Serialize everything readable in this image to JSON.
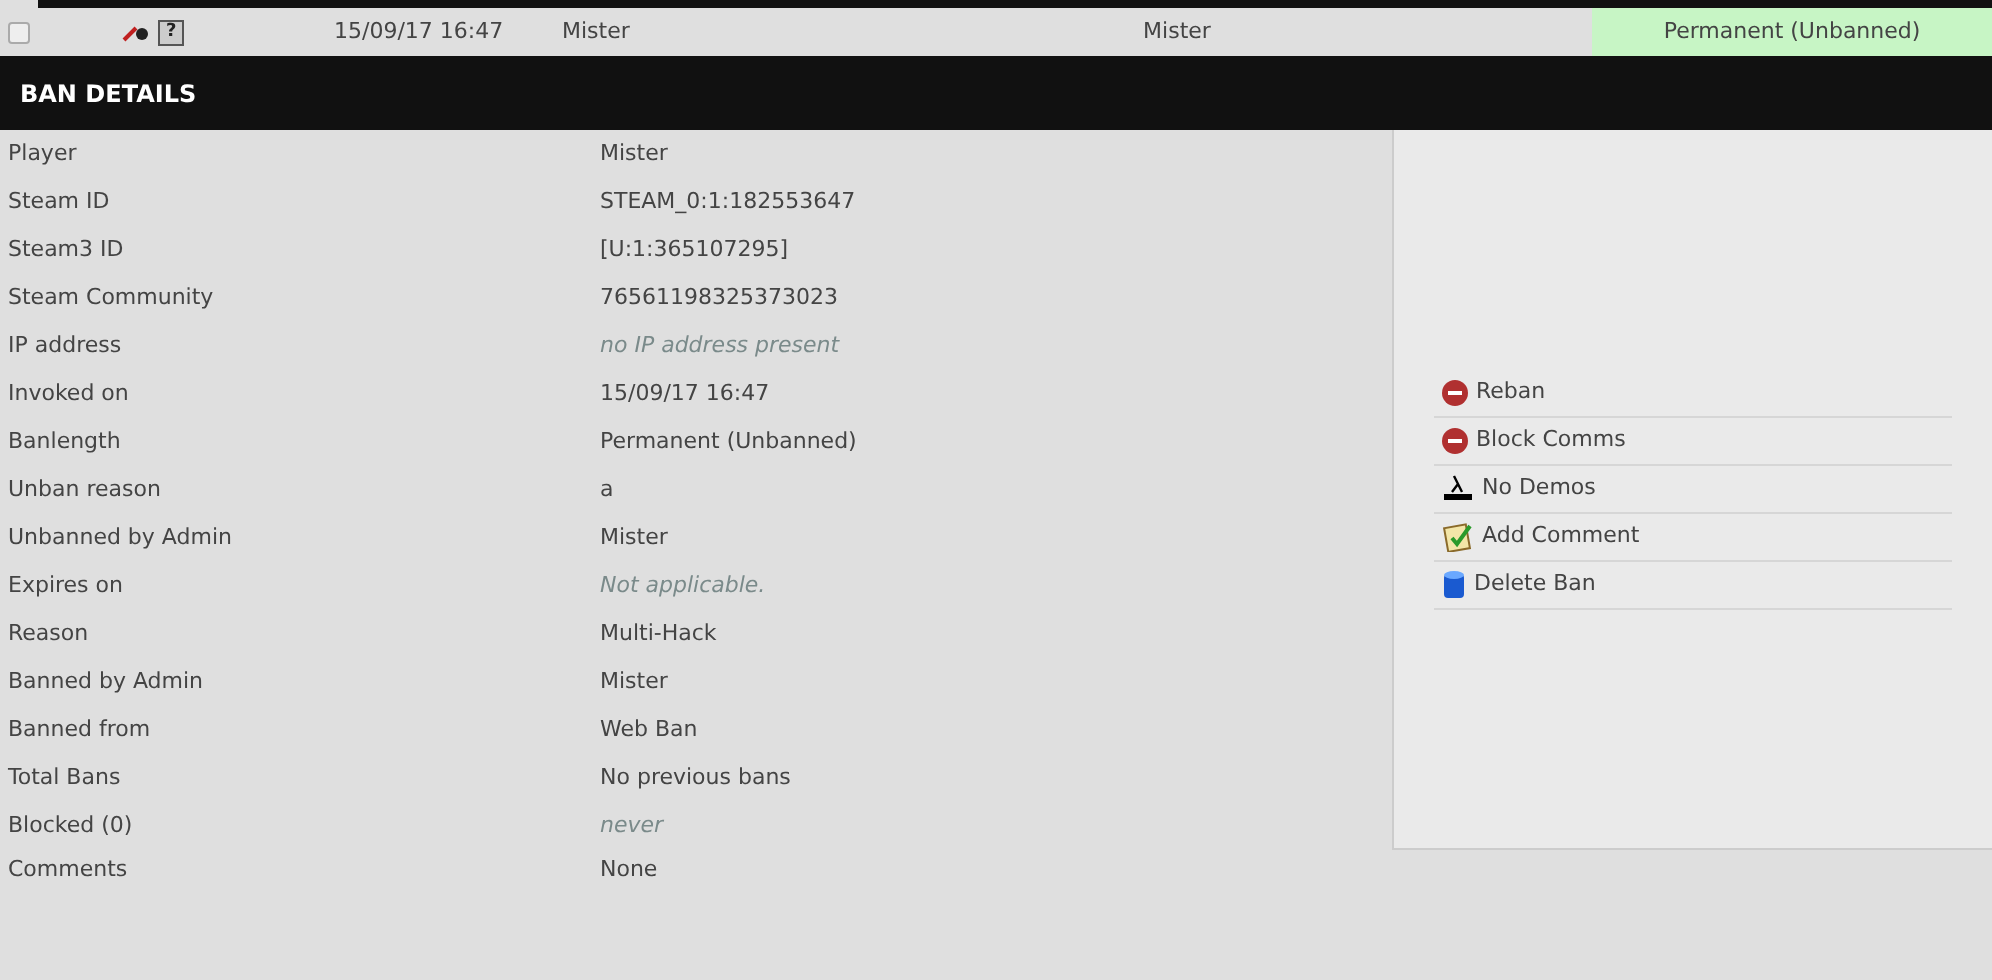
{
  "ban_row": {
    "checked": false,
    "help_icon_label": "?",
    "date": "15/09/17 16:47",
    "player": "Mister",
    "admin": "Mister",
    "length": "Permanent (Unbanned)"
  },
  "section_title": "BAN DETAILS",
  "details": [
    {
      "label": "Player",
      "value": "Mister",
      "muted": false
    },
    {
      "label": "Steam ID",
      "value": "STEAM_0:1:182553647",
      "muted": false
    },
    {
      "label": "Steam3 ID",
      "value": "[U:1:365107295]",
      "muted": false
    },
    {
      "label": "Steam Community",
      "value": "76561198325373023",
      "muted": false
    },
    {
      "label": "IP address",
      "value": "no IP address present",
      "muted": true
    },
    {
      "label": "Invoked on",
      "value": "15/09/17 16:47",
      "muted": false
    },
    {
      "label": "Banlength",
      "value": "Permanent (Unbanned)",
      "muted": false
    },
    {
      "label": "Unban reason",
      "value": "a",
      "muted": false
    },
    {
      "label": "Unbanned by Admin",
      "value": "Mister",
      "muted": false
    },
    {
      "label": "Expires on",
      "value": "Not applicable.",
      "muted": true
    },
    {
      "label": "Reason",
      "value": "Multi-Hack",
      "muted": false
    },
    {
      "label": "Banned by Admin",
      "value": "Mister",
      "muted": false
    },
    {
      "label": "Banned from",
      "value": "Web Ban",
      "muted": false
    },
    {
      "label": "Total Bans",
      "value": "No previous bans",
      "muted": false
    },
    {
      "label": "Blocked (0)",
      "value": "never",
      "muted": true
    }
  ],
  "comments": {
    "label": "Comments",
    "value": "None"
  },
  "actions": [
    {
      "kind": "block",
      "label": "Reban"
    },
    {
      "kind": "block",
      "label": "Block Comms"
    },
    {
      "kind": "demo",
      "label": "No Demos"
    },
    {
      "kind": "comment",
      "label": "Add Comment"
    },
    {
      "kind": "delete",
      "label": "Delete Ban"
    }
  ]
}
